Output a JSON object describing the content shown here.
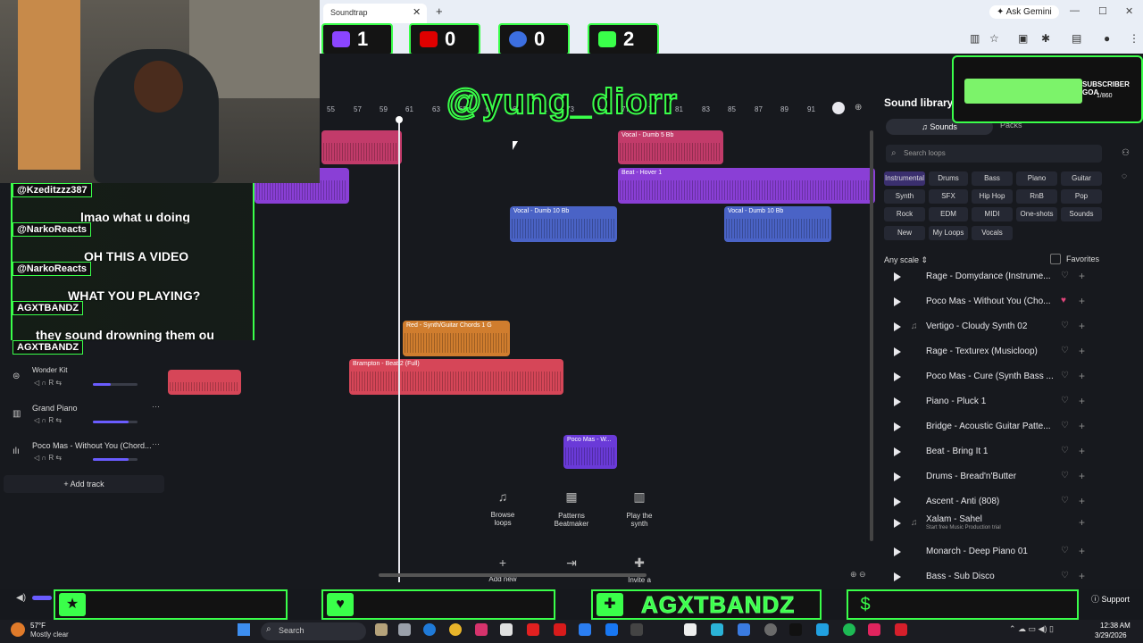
{
  "browser": {
    "tab_title": "Soundtrap",
    "ask_gemini": "Ask Gemini"
  },
  "counters": [
    {
      "platform": "twitch",
      "value": "1",
      "color": "#8b45ff"
    },
    {
      "platform": "youtube",
      "value": "0",
      "color": "#e00000"
    },
    {
      "platform": "facebook",
      "value": "0",
      "color": "#3c6fe0"
    },
    {
      "platform": "kick",
      "value": "2",
      "color": "#3aff4a"
    }
  ],
  "watermark": "@yung_diorr",
  "ruler": [
    "55",
    "57",
    "59",
    "61",
    "63",
    "65",
    "67",
    "69",
    "71",
    "73",
    "75",
    "77",
    "79",
    "81",
    "83",
    "85",
    "87",
    "89",
    "91"
  ],
  "chat": [
    {
      "user": "@Kzeditzzz387",
      "message": "lmao what u doing"
    },
    {
      "user": "@NarkoReacts",
      "message": "OH THIS A VIDEO"
    },
    {
      "user": "@NarkoReacts",
      "message": "WHAT YOU PLAYING?"
    },
    {
      "user": "AGXTBANDZ",
      "message": "they sound drowning them ou"
    },
    {
      "user": "AGXTBANDZ",
      "message": ""
    }
  ],
  "clips": [
    {
      "label": "Vocal - Dumb 5 Bb",
      "type": "pink"
    },
    {
      "label": "Beat - Hover 1",
      "type": "purple"
    },
    {
      "label": "Vocal - Dumb 10 Bb",
      "type": "blue"
    },
    {
      "label": "Vocal - Dumb 10 Bb",
      "type": "blue"
    },
    {
      "label": "Red - Synth/Guitar Chords 1 G",
      "type": "orange"
    },
    {
      "label": "Brampton - Beat 2 (Full)",
      "type": "red"
    },
    {
      "label": "Poco Mas - W...",
      "type": "violet"
    }
  ],
  "tracks": [
    {
      "name": "Wonder Kit"
    },
    {
      "name": "Grand Piano"
    },
    {
      "name": "Poco Mas - Without You (Chord..."
    }
  ],
  "add_track": "+ Add track",
  "quick_actions": [
    {
      "line1": "Browse",
      "line2": "loops"
    },
    {
      "line1": "Patterns",
      "line2": "Beatmaker"
    },
    {
      "line1": "Play the",
      "line2": "synth"
    },
    {
      "line1": "Add new",
      "line2": ""
    },
    {
      "line1": "",
      "line2": ""
    },
    {
      "line1": "Invite a",
      "line2": ""
    }
  ],
  "library": {
    "title": "Sound library",
    "tab_sounds": "Sounds",
    "tab_packs": "Packs",
    "search_placeholder": "Search loops",
    "chips": [
      [
        "Instrumental",
        "Drums",
        "Bass",
        "Piano",
        "Guitar"
      ],
      [
        "Synth",
        "SFX",
        "Hip Hop",
        "RnB",
        "Pop"
      ],
      [
        "Rock",
        "EDM",
        "MIDI",
        "One-shots",
        "Sounds"
      ],
      [
        "New",
        "My Loops",
        "Vocals"
      ]
    ],
    "scale": "Any scale",
    "favorites": "Favorites",
    "loops": [
      {
        "name": "Rage - Domydance (Instrume...",
        "sub": ""
      },
      {
        "name": "Poco Mas - Without You (Cho...",
        "sub": "",
        "fav": true
      },
      {
        "name": "Vertigo - Cloudy Synth 02",
        "sub": ""
      },
      {
        "name": "Rage - Texturex (Musicloop)",
        "sub": ""
      },
      {
        "name": "Poco Mas - Cure (Synth Bass ...",
        "sub": ""
      },
      {
        "name": "Piano - Pluck 1",
        "sub": ""
      },
      {
        "name": "Bridge - Acoustic Guitar Patte...",
        "sub": ""
      },
      {
        "name": "Beat - Bring It 1",
        "sub": ""
      },
      {
        "name": "Drums - Bread'n'Butter",
        "sub": ""
      },
      {
        "name": "Ascent - Anti (808)",
        "sub": ""
      },
      {
        "name": "Xalam - Sahel",
        "sub": "Start free Music Production trial"
      },
      {
        "name": "Monarch - Deep Piano 01",
        "sub": ""
      },
      {
        "name": "Bass - Sub Disco",
        "sub": ""
      }
    ]
  },
  "subscriber_goal": {
    "label": "SUBSCRIBER GOA",
    "count": "1/860"
  },
  "overlay_name": "AGXTBANDZ",
  "support": "Support",
  "taskbar": {
    "temp": "57°F",
    "weather": "Mostly clear",
    "search": "Search",
    "time": "12:38 AM",
    "date": "3/29/2026"
  },
  "colors": {
    "accent_green": "#3aff4a",
    "playhead": "#e8e8ee"
  }
}
